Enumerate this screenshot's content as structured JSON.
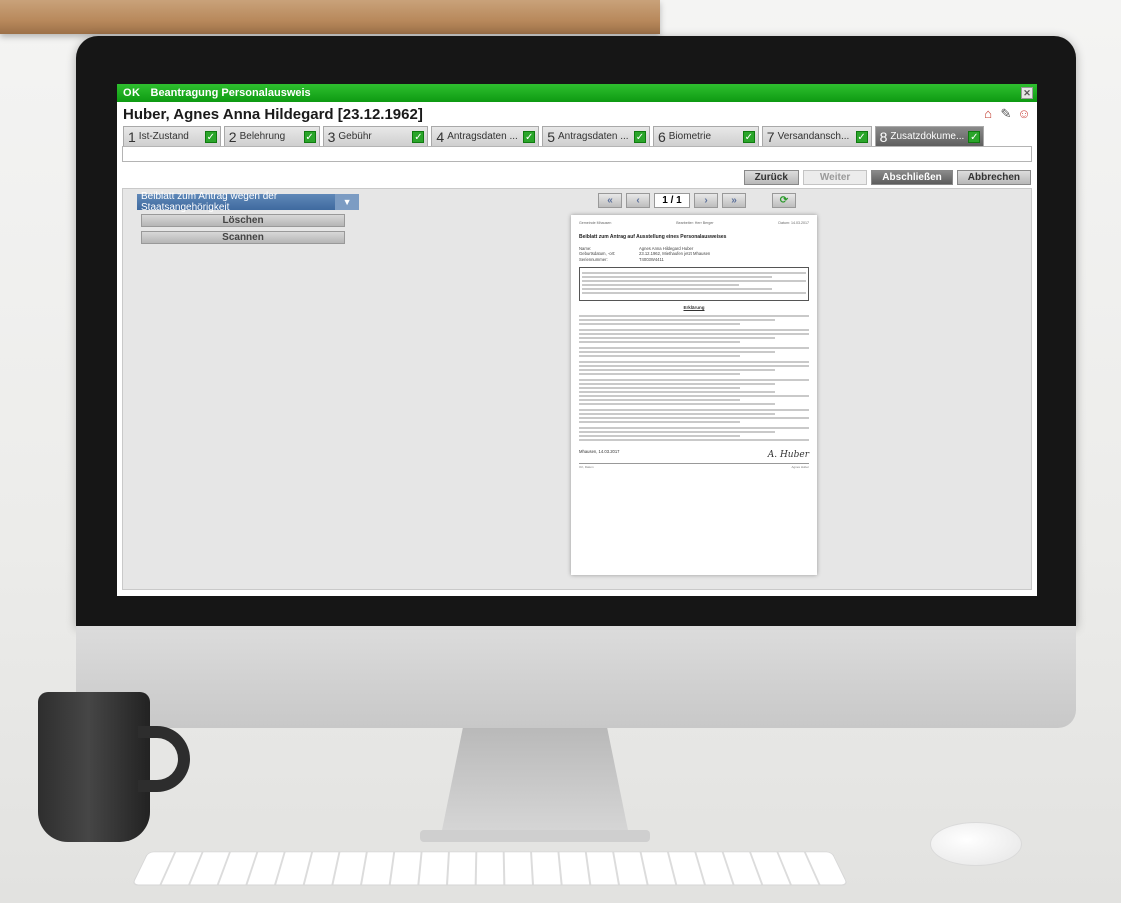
{
  "app": {
    "logo": "OK",
    "window_title": "Beantragung Personalausweis",
    "close_glyph": "✕"
  },
  "patient": {
    "name": "Huber, Agnes Anna Hildegard [23.12.1962]"
  },
  "header_icons": [
    "home-icon",
    "paperclip-icon",
    "person-icon"
  ],
  "tabs": [
    {
      "num": "1",
      "label": "Ist-Zustand",
      "checked": true
    },
    {
      "num": "2",
      "label": "Belehrung",
      "checked": true
    },
    {
      "num": "3",
      "label": "Gebühr",
      "checked": true
    },
    {
      "num": "4",
      "label": "Antragsdaten ...",
      "checked": true
    },
    {
      "num": "5",
      "label": "Antragsdaten ...",
      "checked": true
    },
    {
      "num": "6",
      "label": "Biometrie",
      "checked": true
    },
    {
      "num": "7",
      "label": "Versandansch...",
      "checked": true
    },
    {
      "num": "8",
      "label": "Zusatzdokume...",
      "checked": true,
      "active": true
    }
  ],
  "actions": {
    "back": "Zurück",
    "next": "Weiter",
    "finish": "Abschließen",
    "cancel": "Abbrechen"
  },
  "left_panel": {
    "document_select": "Beiblatt zum Antrag wegen der Staatsangehörigkeit",
    "delete": "Löschen",
    "scan": "Scannen"
  },
  "pager": {
    "page": "1 / 1"
  },
  "document": {
    "head_left": "Gemeinde Mhausen",
    "head_mid": "Bearbeiter: Herr Berger",
    "head_right": "Datum: 14.03.2017",
    "title": "Beiblatt zum Antrag auf Ausstellung eines Personalausweises",
    "name_label": "Name:",
    "name_value": "Agnes Anna Hildegard Huber",
    "birth_label": "Geburtsdatum, -ort:",
    "birth_value": "23.12.1962, Miethaufen jetzt Mhausen",
    "serial_label": "Seriennummer:",
    "serial_value": "T4003W4411",
    "section": "Erklärung",
    "place_date": "Mhausen, 14.03.2017",
    "foot_left": "Ort, Datum",
    "foot_right": "Agnes Huber",
    "signature": "A. Huber"
  }
}
